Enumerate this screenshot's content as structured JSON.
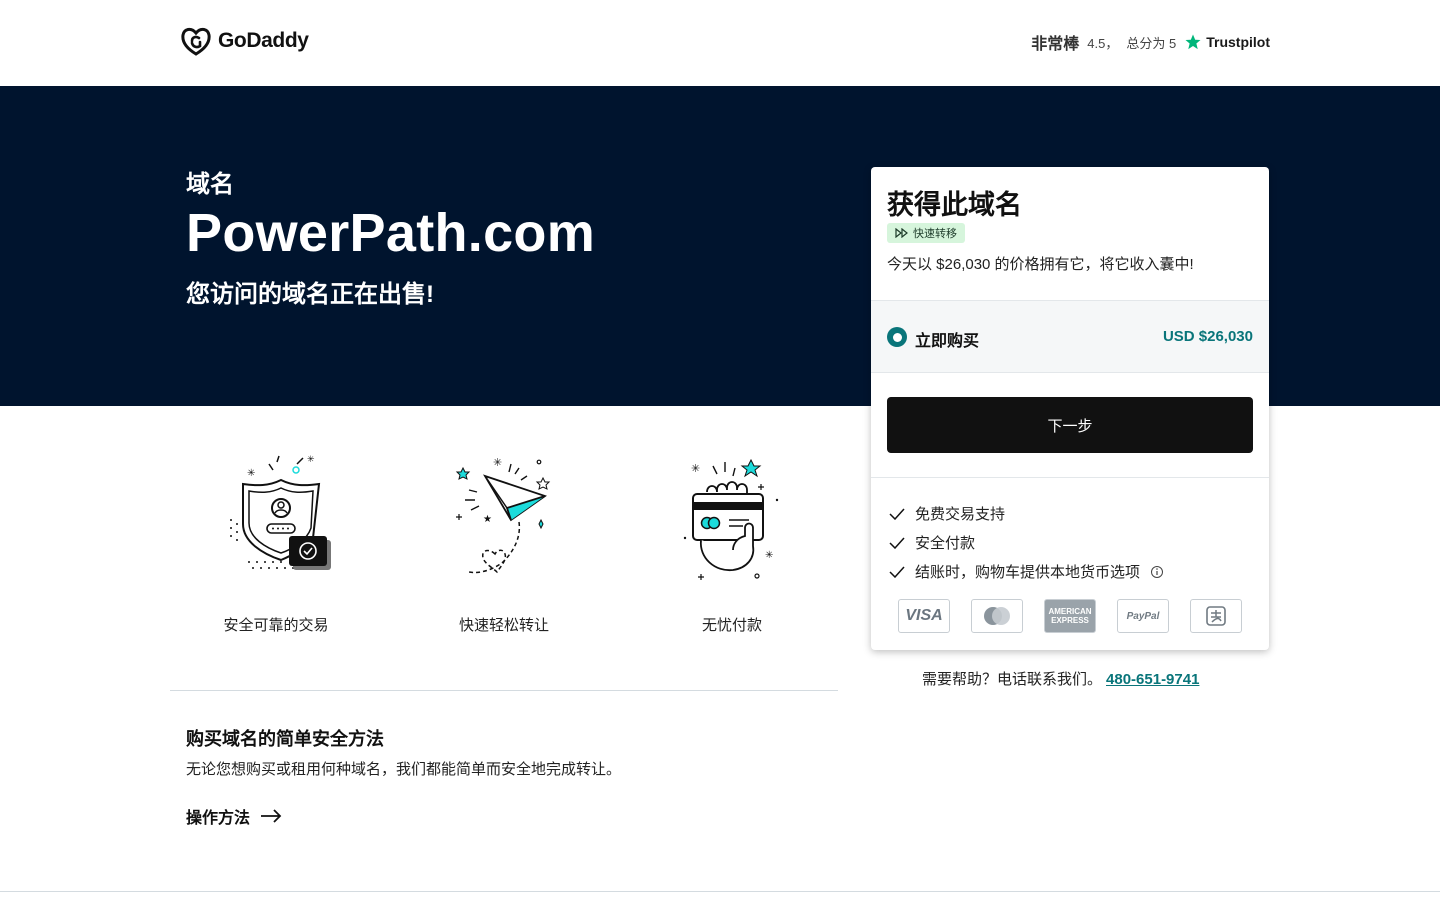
{
  "header": {
    "logo_text": "GoDaddy",
    "rating_label": "非常棒",
    "rating_score": "4.5，",
    "rating_total": "总分为 5",
    "trustpilot": "Trustpilot"
  },
  "hero": {
    "kicker": "域名",
    "domain": "PowerPath.com",
    "subtitle": "您访问的域名正在出售!"
  },
  "features": [
    {
      "label": "安全可靠的交易",
      "icon": "shield-icon"
    },
    {
      "label": "快速轻松转让",
      "icon": "paper-plane-icon"
    },
    {
      "label": "无忧付款",
      "icon": "card-hand-icon"
    }
  ],
  "section": {
    "title": "购买域名的简单安全方法",
    "desc": "无论您想购买或租用何种域名，我们都能简单而安全地完成转让。",
    "link": "操作方法"
  },
  "card": {
    "title": "获得此域名",
    "badge": "快速转移",
    "desc": "今天以 $26,030 的价格拥有它，将它收入囊中!",
    "option_label": "立即购买",
    "option_price": "USD $26,030",
    "next_button": "下一步",
    "checks": [
      "免费交易支持",
      "安全付款",
      "结账时，购物车提供本地货币选项"
    ],
    "payments": [
      "VISA",
      "Mastercard",
      "AMERICAN EXPRESS",
      "PayPal",
      "Alipay"
    ]
  },
  "help": {
    "text": "需要帮助？电话联系我们。",
    "phone": "480-651-9741"
  },
  "colors": {
    "hero_bg": "#00142e",
    "accent": "#09757a",
    "badge_bg": "#d6f5dc",
    "button_bg": "#111111"
  }
}
